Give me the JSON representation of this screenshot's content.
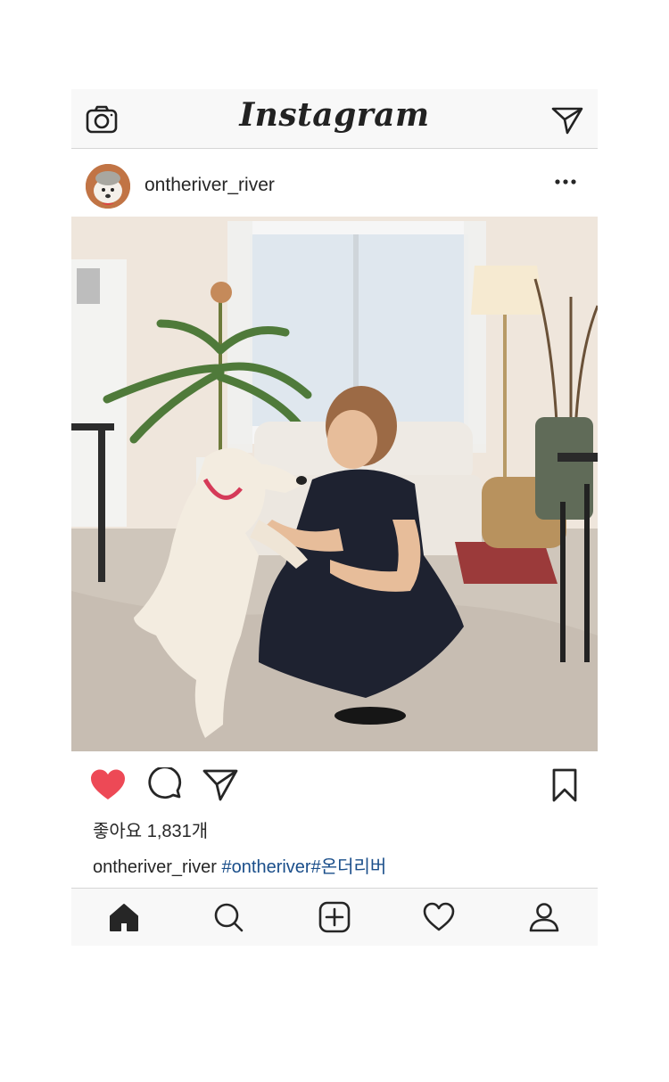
{
  "app": {
    "logo_text": "Instagram"
  },
  "topbar": {
    "left_icon": "camera-icon",
    "right_icon": "send-icon"
  },
  "post": {
    "username": "ontheriver_river",
    "more_icon": "more-options-icon",
    "likes_text": "좋아요 1,831개",
    "caption": {
      "username": "ontheriver_river",
      "hashtags": "#ontheriver#온더리버"
    },
    "liked": true,
    "like_color": "#ed4956"
  },
  "actions": [
    "heart-icon",
    "comment-icon",
    "share-icon",
    "bookmark-icon"
  ],
  "bottom_nav": [
    "home-icon",
    "search-icon",
    "add-post-icon",
    "activity-heart-icon",
    "profile-icon"
  ],
  "colors": {
    "hashtag": "#1a4e8a",
    "bar_bg": "#f8f8f8"
  }
}
